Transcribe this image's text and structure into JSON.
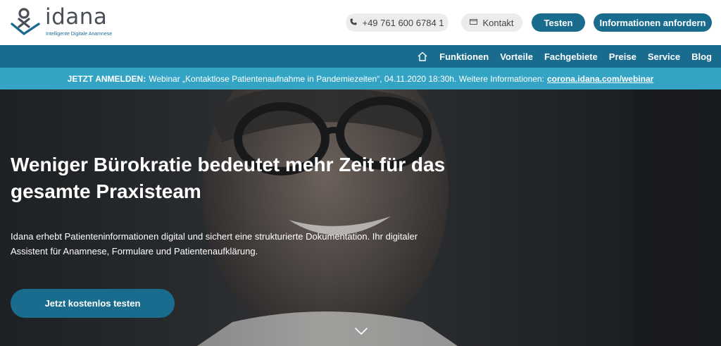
{
  "brand": {
    "name": "idana",
    "tagline": "Intelligente Digitale Anamnese",
    "primary_color": "#1a6c8f",
    "accent_color": "#34a4c4"
  },
  "header": {
    "phone": {
      "icon": "phone-icon",
      "label": "+49 761 600 6784 1"
    },
    "kontakt": {
      "icon": "mail-icon",
      "label": "Kontakt"
    },
    "testen_label": "Testen",
    "info_label": "Informationen anfordern"
  },
  "nav": {
    "home_icon": "home-icon",
    "items": [
      "Funktionen",
      "Vorteile",
      "Fachgebiete",
      "Preise",
      "Service",
      "Blog"
    ]
  },
  "announcement": {
    "prefix": "JETZT ANMELDEN:",
    "text": "Webinar „Kontaktlose Patientenaufnahme in Pandemiezeiten“, 04.11.2020 18:30h. Weitere Informationen:",
    "link": "corona.idana.com/webinar"
  },
  "hero": {
    "title": "Weniger Bürokratie bedeutet mehr Zeit für das gesamte Praxisteam",
    "text": "Idana erhebt Patienteninformationen digital und sichert eine strukturierte Dokumentation. Ihr digitaler Assistent für Anamnese, Formulare und Patientenaufklärung.",
    "cta_label": "Jetzt kostenlos testen",
    "scroll_icon": "chevron-down-icon"
  }
}
